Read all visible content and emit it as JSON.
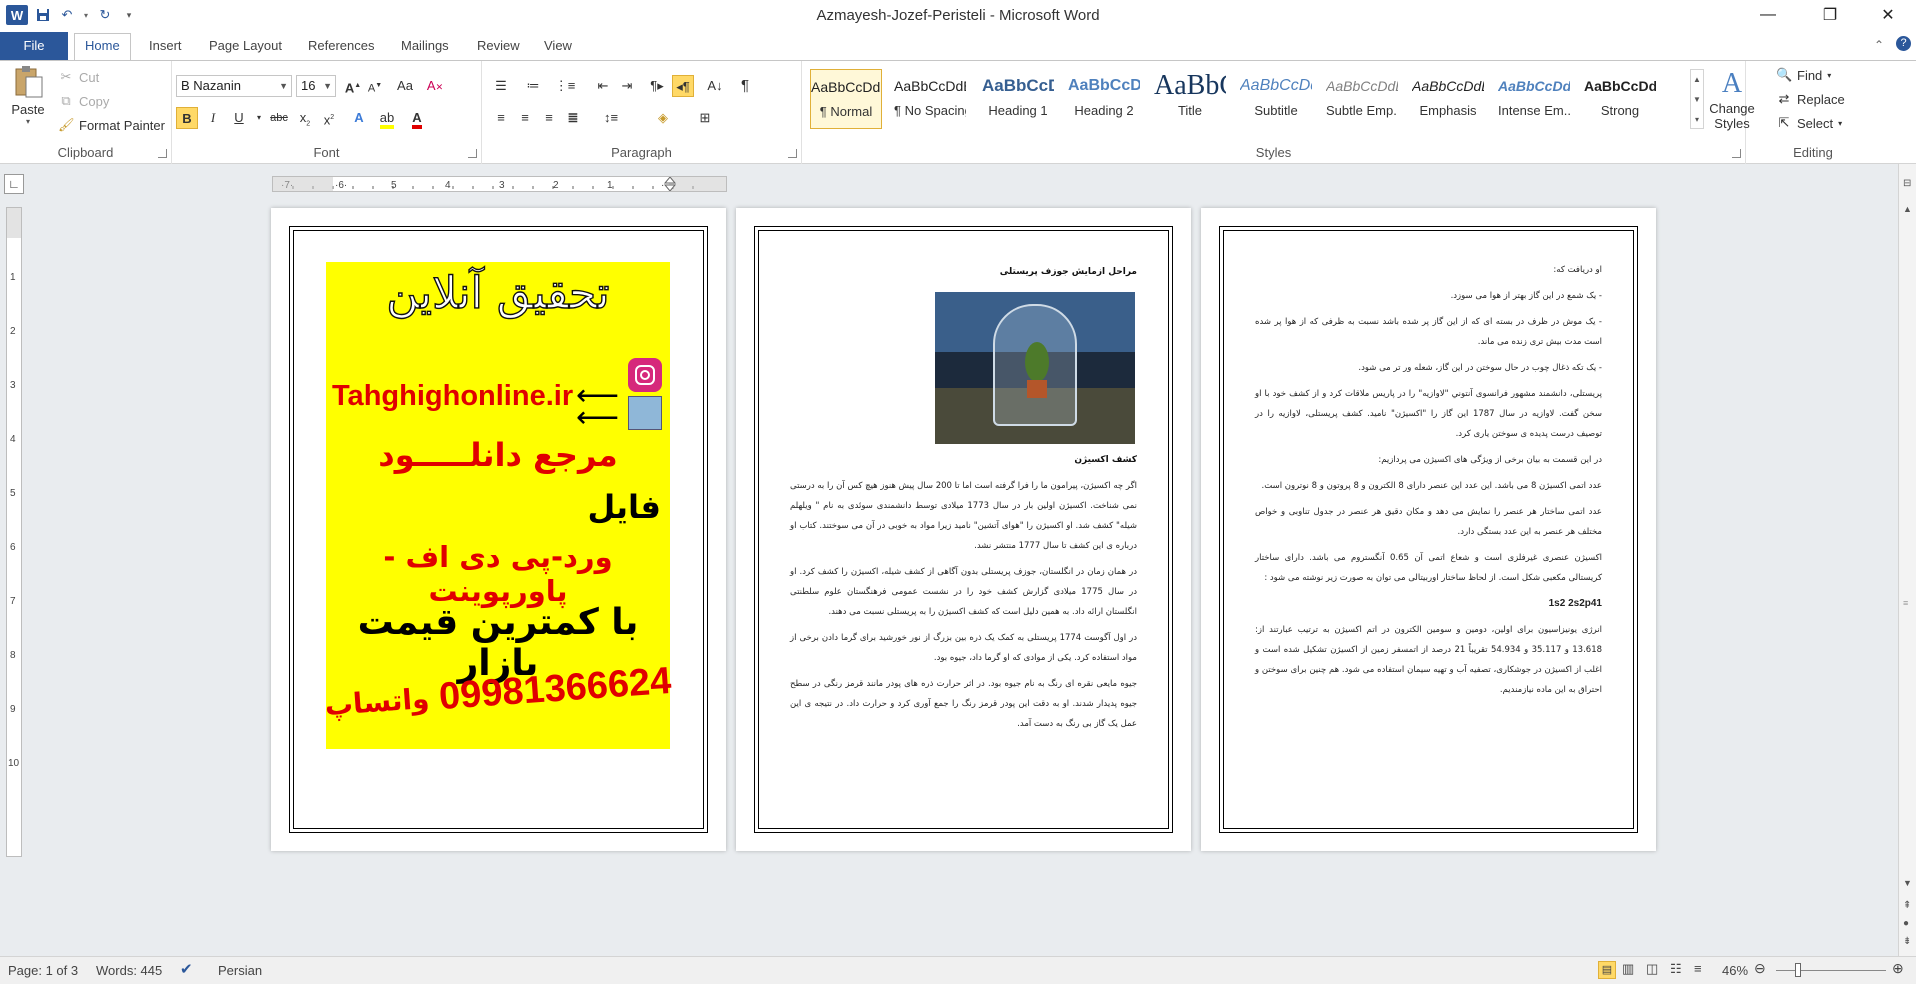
{
  "window": {
    "title": "Azmayesh-Jozef-Peristeli  -  Microsoft Word",
    "app_icon_letter": "W",
    "buttons": {
      "minimize": "—",
      "restore": "❐",
      "close": "✕"
    }
  },
  "tabs": {
    "file": "File",
    "items": [
      "Home",
      "Insert",
      "Page Layout",
      "References",
      "Mailings",
      "Review",
      "View"
    ]
  },
  "clipboard": {
    "paste": "Paste",
    "cut": "Cut",
    "copy": "Copy",
    "format_painter": "Format Painter",
    "label": "Clipboard"
  },
  "font": {
    "name": "B Nazanin",
    "size": "16",
    "label": "Font",
    "accent_red": "#e00000",
    "highlight_yellow": "#ffff00"
  },
  "paragraph": {
    "label": "Paragraph"
  },
  "styles": {
    "label": "Styles",
    "items": [
      {
        "sample": "AaBbCcDdEe",
        "name": "¶ Normal"
      },
      {
        "sample": "AaBbCcDdEe",
        "name": "¶ No Spacing"
      },
      {
        "sample": "AaBbCcDdEe",
        "name": "Heading 1"
      },
      {
        "sample": "AaBbCcDdEe",
        "name": "Heading 2"
      },
      {
        "sample": "AaBbCcDdEe",
        "name": "Title"
      },
      {
        "sample": "AaBbCcDdEe",
        "name": "Subtitle"
      },
      {
        "sample": "AaBbCcDdEe",
        "name": "Subtle Emp..."
      },
      {
        "sample": "AaBbCcDdEe",
        "name": "Emphasis"
      },
      {
        "sample": "AaBbCcDdEe",
        "name": "Intense Em..."
      },
      {
        "sample": "AaBbCcDdEe",
        "name": "Strong"
      }
    ],
    "change_styles": "Change Styles"
  },
  "editing": {
    "find": "Find",
    "replace": "Replace",
    "select": "Select",
    "label": "Editing"
  },
  "page1": {
    "title": "تحقیق آنلاین",
    "site": "Tahghighonline.ir",
    "line1": "مرجع دانلـــــود",
    "line2": "فایل",
    "line3": "ورد-پی دی اف - پاورپوینت",
    "line4": "با کمترین قیمت بازار",
    "phone": "09981366624",
    "whatsapp": "واتساپ"
  },
  "page2": {
    "heading": "مراحل ازمایش جوزف پریستلی",
    "subheading": "کشف اکسیژن",
    "paragraphs": [
      "اگر چه اکسیژن، پیرامون ما را فرا گرفته است اما تا 200 سال پیش هنوز هیچ کس آن را به درستی نمی شناخت. اکسیژن اولین بار در سال 1773 میلادی توسط دانشمندی سوئدی به نام \" ویلهلم شیله\" کشف شد. او اکسیژن را \"هوای آتشین\" نامید زیرا مواد به خوبی در آن می سوختند. کتاب او درباره ی این کشف تا سال 1777 منتشر نشد.",
      "در همان زمان در انگلستان، جوزف پریستلی بدون آگاهی از کشف شیله، اکسیژن را کشف کرد. او در سال 1775 میلادی گزارش کشف خود را در نشست عمومی فرهنگستان علوم سلطنتی انگلستان ارائه داد. به همین دلیل است که کشف اکسیژن را به پریستلی نسبت می دهند.",
      "در اول آگوست 1774 پریستلی به کمک یک ذره بین بزرگ از نور خورشید برای گرما دادن برخی از مواد استفاده کرد. یکی از موادی که او گرما داد، جیوه بود.",
      "جیوه مایعی نقره ای رنگ به نام جیوه بود. در اثر حرارت ذره های پودر مانند قرمز رنگی در سطح جیوه پدیدار شدند. او به دقت این پودر قرمز رنگ را جمع آوری کرد و حرارت داد. در نتیجه ی این عمل یک گاز بی رنگ به دست آمد."
    ]
  },
  "page3": {
    "paragraphs": [
      "او دریافت که:",
      "- یک شمع در این گاز بهتر از هوا می سوزد.",
      "- یک موش در ظرف در بسته ای که از این گاز پر شده باشد نسبت به ظرفی که از هوا پر شده است مدت بیش تری زنده می ماند.",
      "- یک تکه ذغال چوب در حال سوختن در این گاز، شعله ور تر می شود.",
      "پریستلی، دانشمند مشهور فرانسوی آنتوني \"لاوازیه\" را در پاریس ملاقات کرد و از کشف خود با او سخن گفت. لاوازیه در سال 1787 این گاز را \"اکسیژن\" نامید. کشف پریستلی، لاوازیه را در توصیف درست پدیده ی سوختن یاری کرد.",
      "در این قسمت به بیان برخی از ویژگی های اکسیژن می پردازیم:",
      "عدد اتمی اکسیژن 8 می باشد. این عدد این عنصر دارای 8 الکترون و 8 پروتون و 8 نوترون است.",
      "عدد اتمی ساختار هر عنصر را نمایش می دهد و مکان دقیق هر عنصر در جدول تناوبی و خواص مختلف هر عنصر به این عدد بستگی دارد.",
      "اکسیژن عنصری غیرفلزی است و شعاع اتمی آن 0.65 آنگستروم می باشد. دارای ساختار کریستالی مکعبی شکل است. از لحاظ ساختار اوربیتالی می توان به صورت زیر نوشته می شود :",
      "1s2 2s2p41",
      "انرژی یونیزاسیون برای اولین، دومین و سومین الکترون در اتم اکسیژن به ترتیب عبارتند از: 13.618 و 35.117 و 54.934 تقریباً 21 درصد از اتمسفر زمین از اکسیژن تشکیل شده است و اغلب از اکسیژن در جوشکاری، تصفیه آب و تهیه سیمان استفاده می شود. هم چنین برای سوختن و احتراق به این ماده نیازمندیم."
    ]
  },
  "status": {
    "page": "Page: 1 of 3",
    "words": "Words: 445",
    "language": "Persian",
    "zoom": "46%"
  }
}
